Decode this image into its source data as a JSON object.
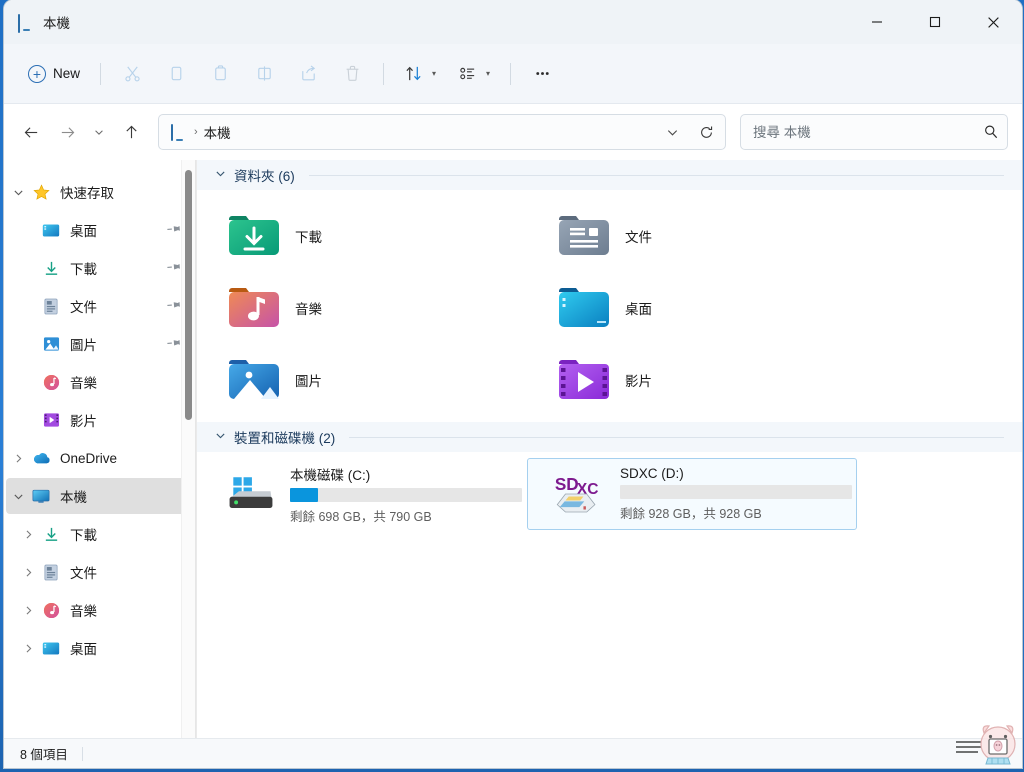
{
  "window": {
    "title": "本機",
    "icon": "monitor-icon",
    "minimize_label": "最小化",
    "maximize_label": "最大化",
    "close_label": "關閉"
  },
  "toolbar": {
    "new_label": "New",
    "items": [
      {
        "name": "cut",
        "icon": "scissors-icon",
        "disabled": true
      },
      {
        "name": "copy",
        "icon": "copy-icon",
        "disabled": true
      },
      {
        "name": "paste",
        "icon": "clipboard-icon",
        "disabled": true
      },
      {
        "name": "rename",
        "icon": "rename-icon",
        "disabled": true
      },
      {
        "name": "share",
        "icon": "share-icon",
        "disabled": true
      },
      {
        "name": "delete",
        "icon": "trash-icon",
        "disabled": true
      }
    ],
    "sort_icon": "sort-arrows-icon",
    "view_icon": "view-list-icon",
    "more_icon": "ellipsis-icon"
  },
  "navbar": {
    "back_icon": "arrow-left-icon",
    "forward_icon": "arrow-right-icon",
    "recent_icon": "chevron-down-icon",
    "up_icon": "arrow-up-icon",
    "breadcrumb": {
      "icon": "monitor-icon",
      "separator": "›",
      "path": "本機"
    },
    "dropdown_icon": "chevron-down-icon",
    "refresh_icon": "refresh-icon"
  },
  "search": {
    "placeholder": "搜尋 本機",
    "value": "",
    "icon": "search-icon"
  },
  "sidebar": {
    "scrollbar": true,
    "items": [
      {
        "label": "快速存取",
        "icon": "star-icon",
        "chevron": "expanded",
        "indent": 0,
        "pinned": false,
        "selected": false
      },
      {
        "label": "桌面",
        "icon": "desktop-folder-icon",
        "chevron": "none",
        "indent": 1,
        "pinned": true,
        "selected": false
      },
      {
        "label": "下載",
        "icon": "downloads-icon",
        "chevron": "none",
        "indent": 1,
        "pinned": true,
        "selected": false
      },
      {
        "label": "文件",
        "icon": "documents-icon",
        "chevron": "none",
        "indent": 1,
        "pinned": true,
        "selected": false
      },
      {
        "label": "圖片",
        "icon": "pictures-icon",
        "chevron": "none",
        "indent": 1,
        "pinned": true,
        "selected": false
      },
      {
        "label": "音樂",
        "icon": "music-icon",
        "chevron": "none",
        "indent": 1,
        "pinned": false,
        "selected": false
      },
      {
        "label": "影片",
        "icon": "videos-icon",
        "chevron": "none",
        "indent": 1,
        "pinned": false,
        "selected": false
      },
      {
        "label": "OneDrive",
        "icon": "onedrive-icon",
        "chevron": "collapsed",
        "indent": 0,
        "pinned": false,
        "selected": false
      },
      {
        "label": "本機",
        "icon": "monitor-icon",
        "chevron": "expanded",
        "indent": 0,
        "pinned": false,
        "selected": true
      },
      {
        "label": "下載",
        "icon": "downloads-icon",
        "chevron": "collapsed",
        "indent": 1,
        "pinned": false,
        "selected": false
      },
      {
        "label": "文件",
        "icon": "documents-icon",
        "chevron": "collapsed",
        "indent": 1,
        "pinned": false,
        "selected": false
      },
      {
        "label": "音樂",
        "icon": "music-icon",
        "chevron": "collapsed",
        "indent": 1,
        "pinned": false,
        "selected": false
      },
      {
        "label": "桌面",
        "icon": "desktop-folder-icon",
        "chevron": "collapsed",
        "indent": 1,
        "pinned": false,
        "selected": false
      }
    ]
  },
  "content": {
    "folders_group": {
      "label": "資料夾 (6)",
      "chevron": "expanded",
      "items": [
        {
          "label": "下載",
          "icon": "downloads-folder-icon"
        },
        {
          "label": "文件",
          "icon": "documents-folder-icon"
        },
        {
          "label": "音樂",
          "icon": "music-folder-icon"
        },
        {
          "label": "桌面",
          "icon": "desktop-folder-icon"
        },
        {
          "label": "圖片",
          "icon": "pictures-folder-icon"
        },
        {
          "label": "影片",
          "icon": "videos-folder-icon"
        }
      ]
    },
    "drives_group": {
      "label": "裝置和磁碟機 (2)",
      "chevron": "expanded",
      "items": [
        {
          "name": "本機磁碟 (C:)",
          "icon": "local-disk-icon",
          "free_text": "剩餘 698 GB，共 790 GB",
          "free_gb": 698,
          "total_gb": 790,
          "used_percent": 12,
          "bar_color": "#0a95dd",
          "selected": false
        },
        {
          "name": "SDXC (D:)",
          "icon": "sdxc-card-icon",
          "free_text": "剩餘 928 GB，共 928 GB",
          "free_gb": 928,
          "total_gb": 928,
          "used_percent": 0,
          "bar_color": "#0a95dd",
          "selected": true
        }
      ]
    }
  },
  "statusbar": {
    "item_count": "8 個項目"
  },
  "colors": {
    "accent": "#0a95dd",
    "titlebar_bg": "#eff3f7",
    "toolbar_bg": "#f3f6fa",
    "group_header_bg": "#f3f7fb",
    "selection_border": "#a5d0ef",
    "sidebar_selected": "#dfdfdf",
    "desktop_bg": "#2a7fd6"
  }
}
